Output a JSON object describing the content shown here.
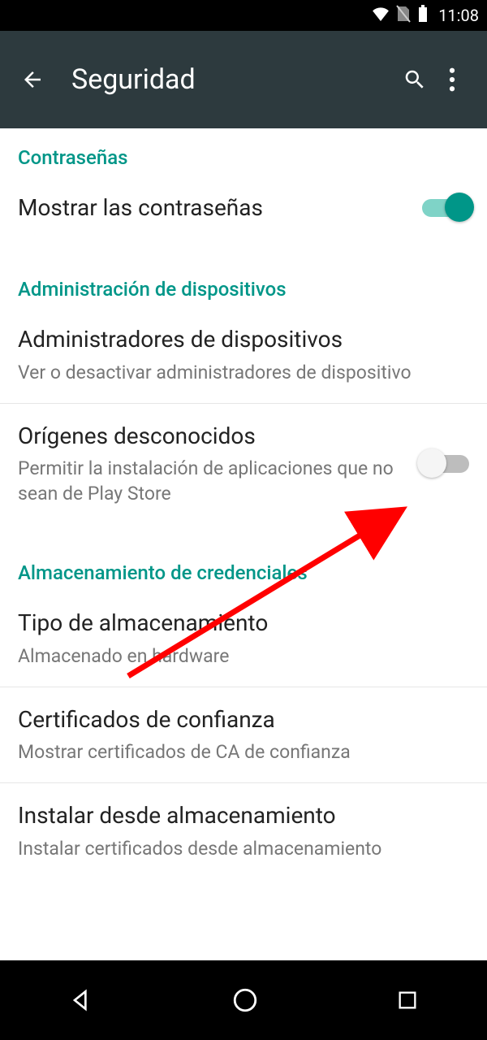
{
  "status": {
    "time": "11:08"
  },
  "appbar": {
    "title": "Seguridad"
  },
  "sections": {
    "passwords": {
      "header": "Contraseñas",
      "show_passwords": {
        "title": "Mostrar las contraseñas"
      }
    },
    "device_admin": {
      "header": "Administración de dispositivos",
      "admins": {
        "title": "Administradores de dispositivos",
        "sub": "Ver o desactivar administradores de dispositivo"
      },
      "unknown": {
        "title": "Orígenes desconocidos",
        "sub": "Permitir la instalación de aplicaciones que no sean de Play Store"
      }
    },
    "credential": {
      "header": "Almacenamiento de credenciales",
      "storage_type": {
        "title": "Tipo de almacenamiento",
        "sub": "Almacenado en hardware"
      },
      "trusted": {
        "title": "Certificados de confianza",
        "sub": "Mostrar certificados de CA de confianza"
      },
      "install": {
        "title": "Instalar desde almacenamiento",
        "sub": "Instalar certificados desde almacenamiento"
      }
    }
  }
}
